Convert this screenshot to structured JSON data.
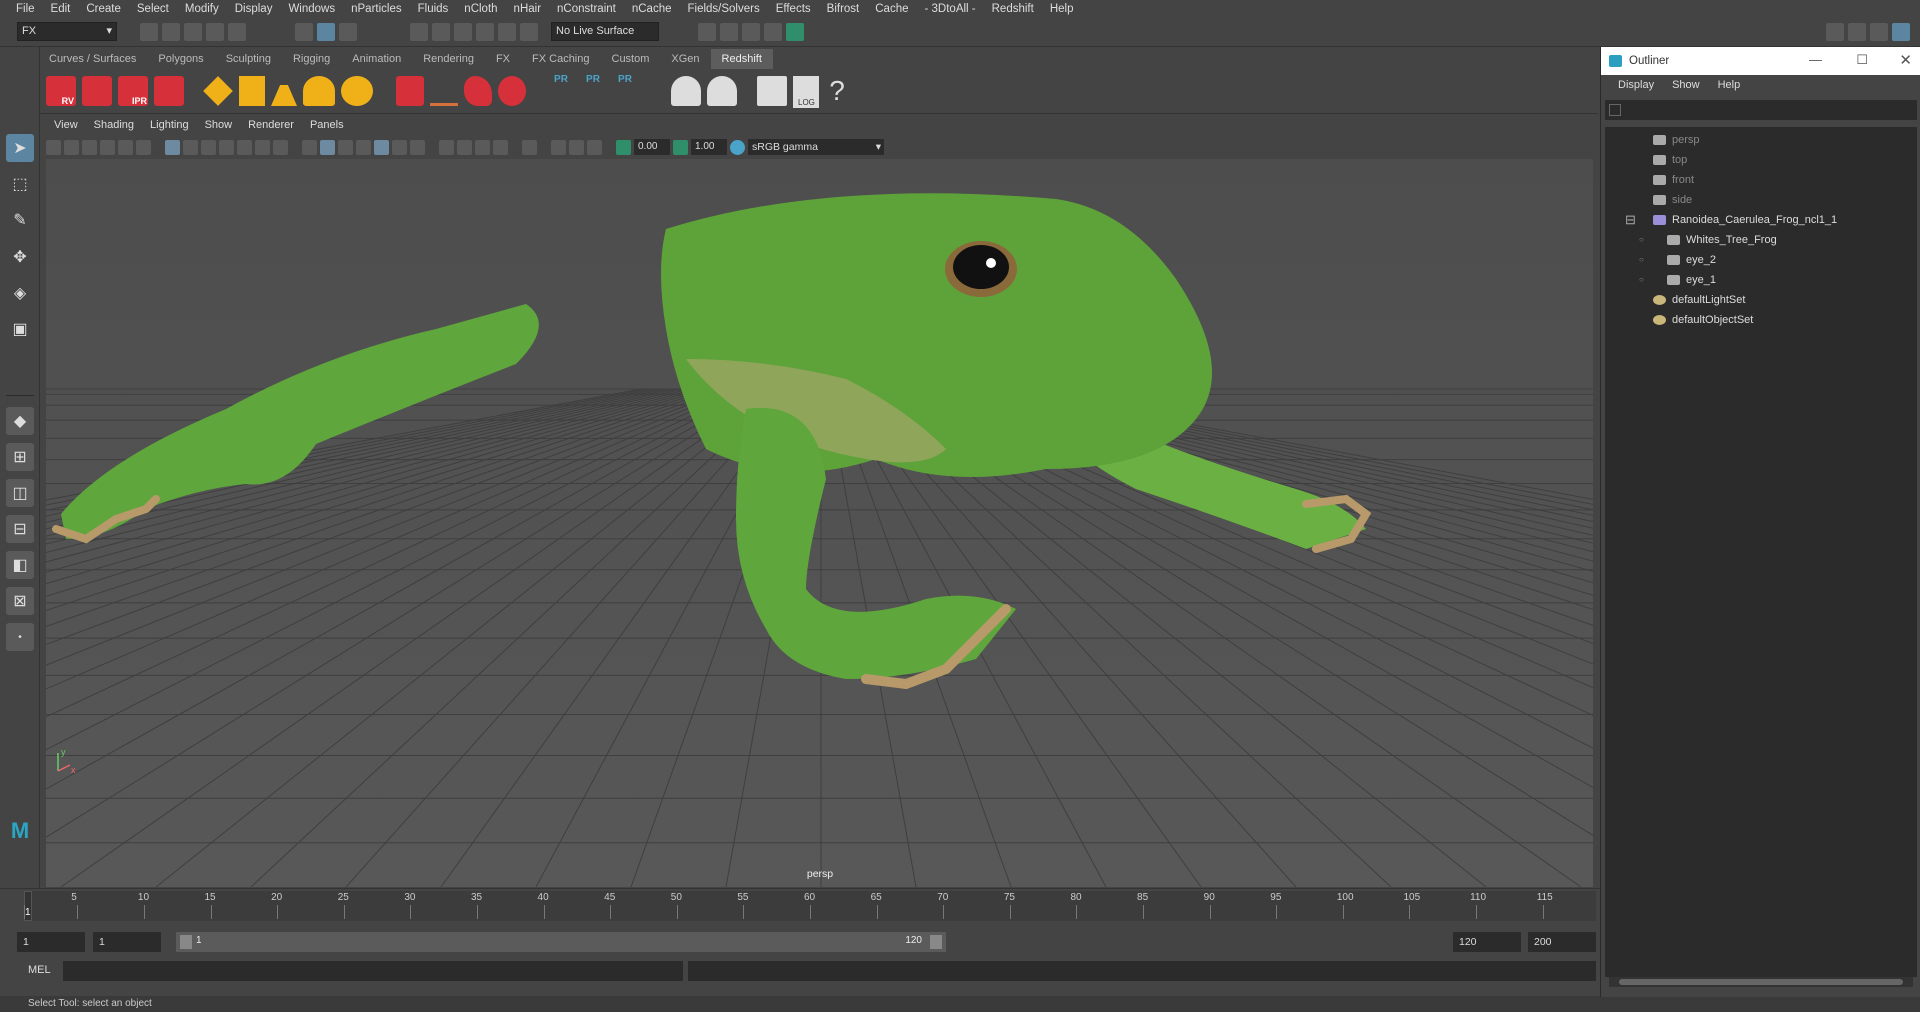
{
  "menubar": [
    "File",
    "Edit",
    "Create",
    "Select",
    "Modify",
    "Display",
    "Windows",
    "nParticles",
    "Fluids",
    "nCloth",
    "nHair",
    "nConstraint",
    "nCache",
    "Fields/Solvers",
    "Effects",
    "Bifrost",
    "Cache",
    "- 3DtoAll -",
    "Redshift",
    "Help"
  ],
  "status": {
    "menu_set": "FX",
    "live_surface": "No Live Surface"
  },
  "shelf_tabs": [
    "Curves / Surfaces",
    "Polygons",
    "Sculpting",
    "Rigging",
    "Animation",
    "Rendering",
    "FX",
    "FX Caching",
    "Custom",
    "XGen",
    "Redshift"
  ],
  "shelf_active": "Redshift",
  "shelf_labels": {
    "rv": "RV",
    "ipr": "IPR",
    "pr1": "PR",
    "pr2": "PR",
    "pr3": "PR",
    "log": "LOG",
    "help": "?"
  },
  "viewport": {
    "menu": [
      "View",
      "Shading",
      "Lighting",
      "Show",
      "Renderer",
      "Panels"
    ],
    "exposure": "0.00",
    "gamma": "1.00",
    "colorspace": "sRGB gamma",
    "camera_label": "persp",
    "axis_y": "y",
    "axis_x": "x"
  },
  "timeline": {
    "ticks": [
      "1",
      "5",
      "10",
      "15",
      "20",
      "25",
      "30",
      "35",
      "40",
      "45",
      "50",
      "55",
      "60",
      "65",
      "70",
      "75",
      "80",
      "85",
      "90",
      "95",
      "100",
      "105",
      "110",
      "115"
    ],
    "current_frame": "1"
  },
  "range": {
    "start": "1",
    "playback_start": "1",
    "slider_start": "1",
    "slider_end": "120",
    "playback_end": "120",
    "end": "200"
  },
  "cmdline": {
    "label": "MEL"
  },
  "helpline": "Select Tool: select an object",
  "outliner": {
    "title": "Outliner",
    "menu": [
      "Display",
      "Show",
      "Help"
    ],
    "items": [
      {
        "label": "persp",
        "icon": "camera-icon",
        "indent": 0,
        "dim": true
      },
      {
        "label": "top",
        "icon": "camera-icon",
        "indent": 0,
        "dim": true
      },
      {
        "label": "front",
        "icon": "camera-icon",
        "indent": 0,
        "dim": true
      },
      {
        "label": "side",
        "icon": "camera-icon",
        "indent": 0,
        "dim": true
      },
      {
        "label": "Ranoidea_Caerulea_Frog_ncl1_1",
        "icon": "joint-icon",
        "indent": 0,
        "dim": false,
        "expanded": true
      },
      {
        "label": "Whites_Tree_Frog",
        "icon": "mesh-icon",
        "indent": 1,
        "dim": false
      },
      {
        "label": "eye_2",
        "icon": "mesh-icon",
        "indent": 1,
        "dim": false
      },
      {
        "label": "eye_1",
        "icon": "mesh-icon",
        "indent": 1,
        "dim": false
      },
      {
        "label": "defaultLightSet",
        "icon": "set-icon",
        "indent": 0,
        "dim": false
      },
      {
        "label": "defaultObjectSet",
        "icon": "set-icon",
        "indent": 0,
        "dim": false
      }
    ]
  },
  "colors": {
    "accent": "#4aa3c8",
    "frog": "#5fa63c",
    "grid": "#3f3f3f"
  }
}
